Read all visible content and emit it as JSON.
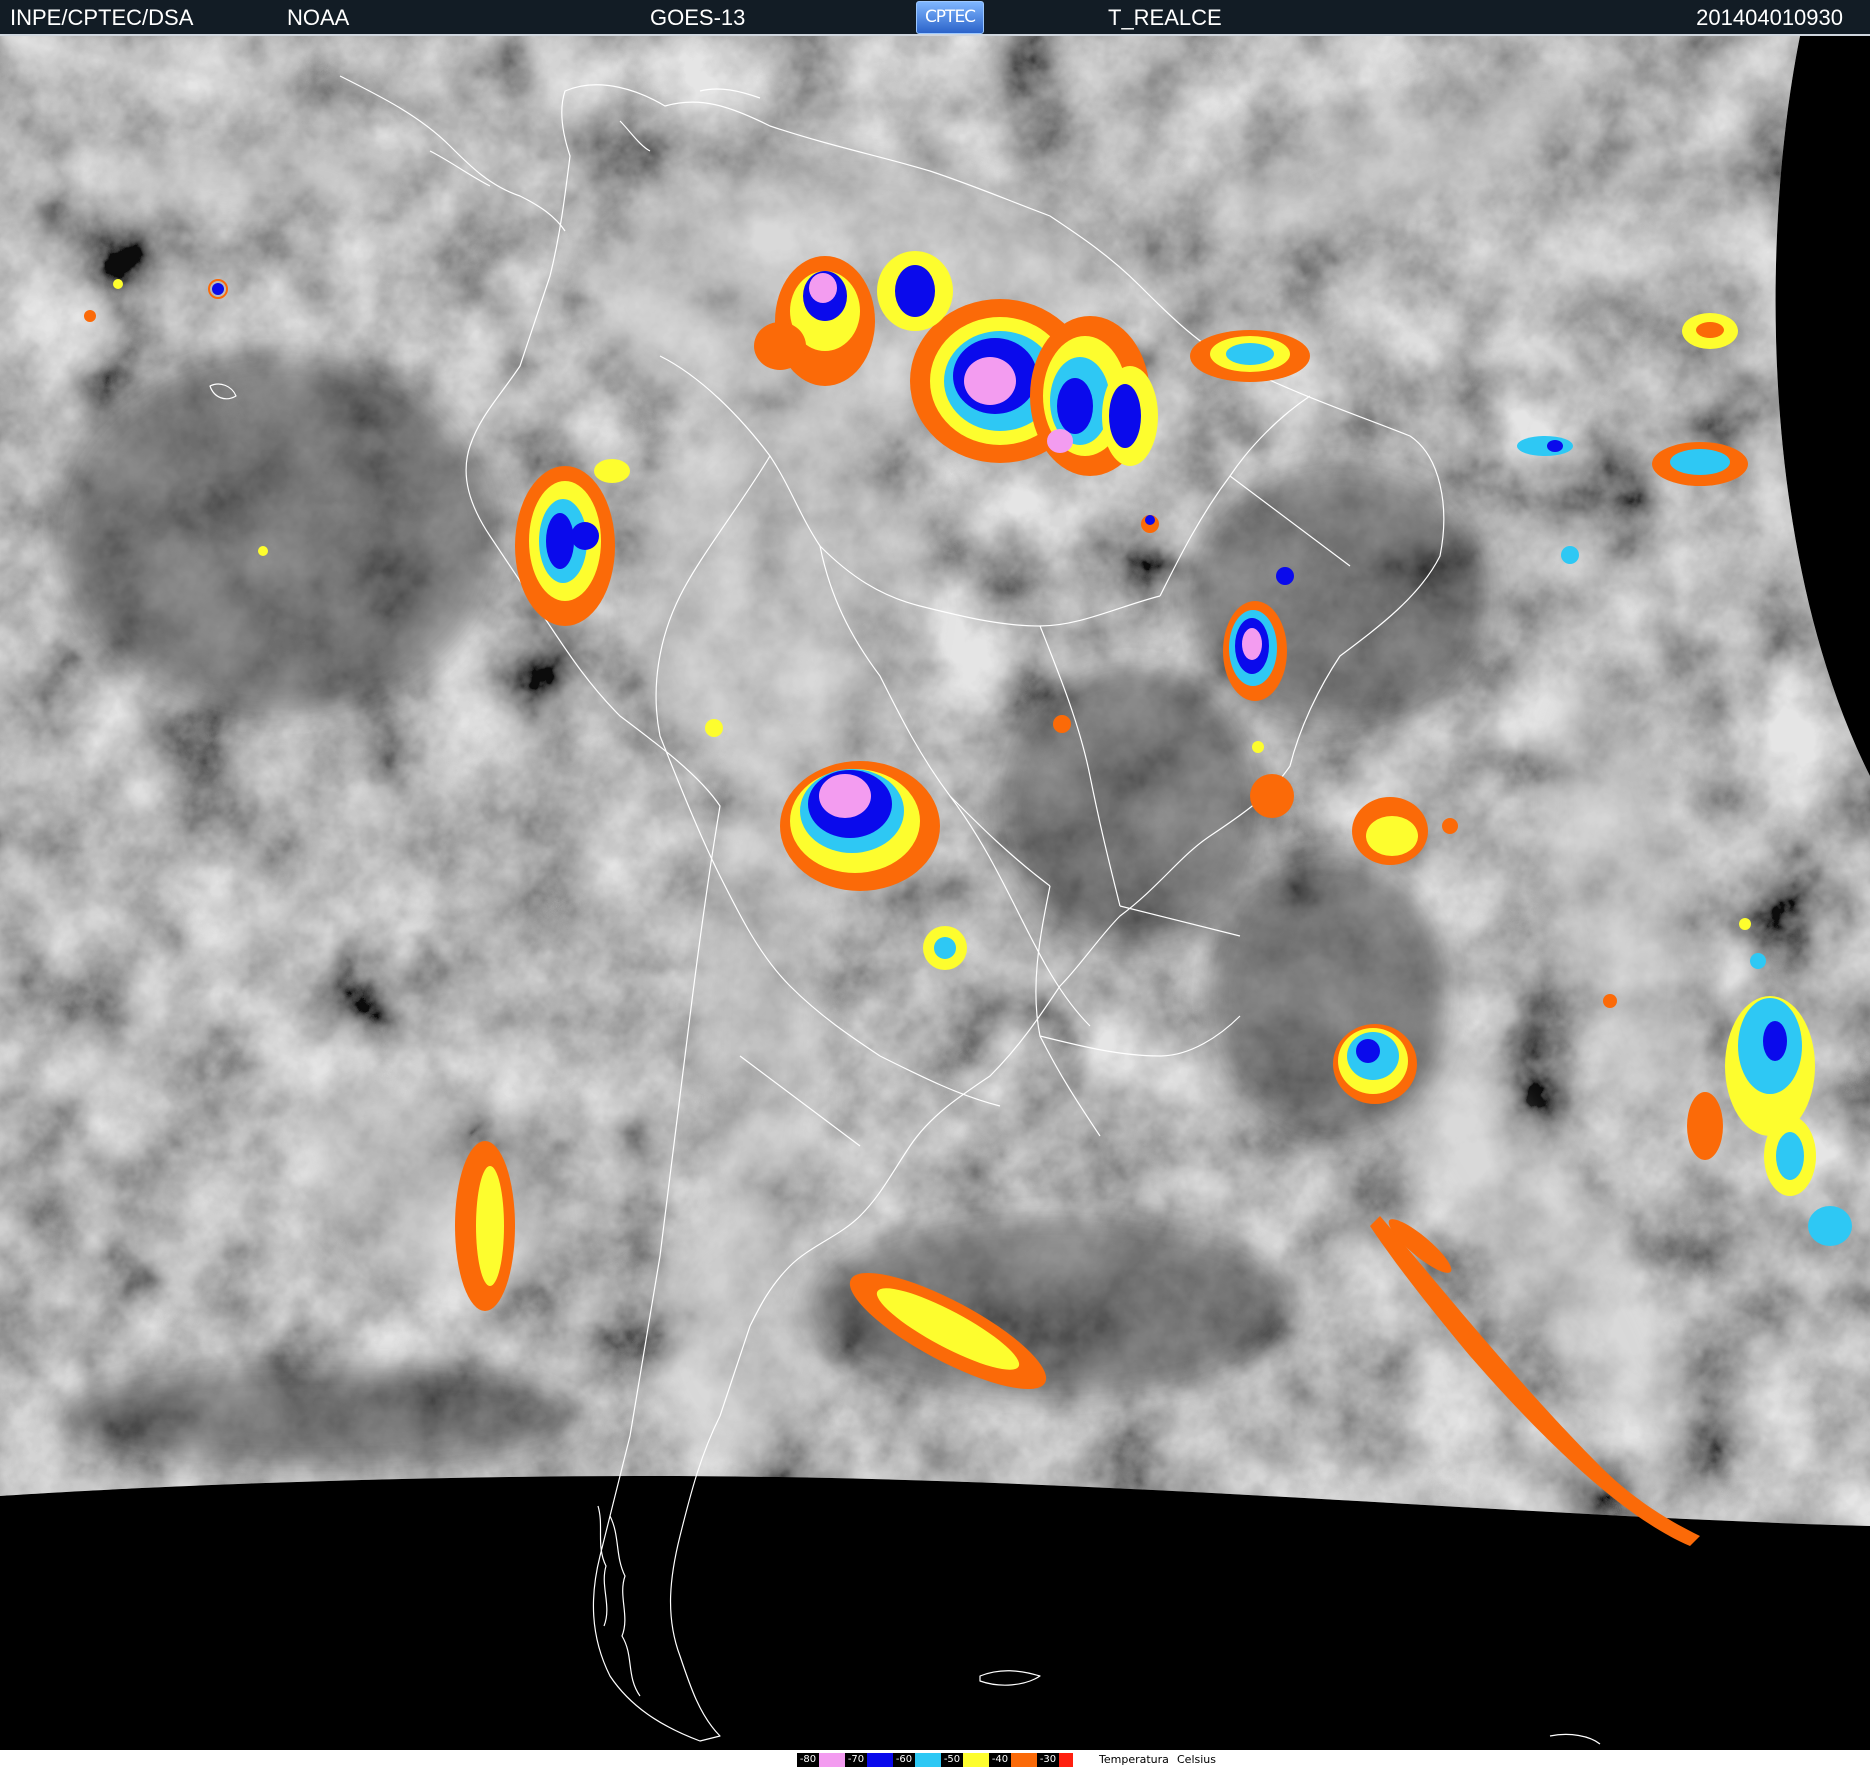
{
  "header": {
    "organization": "INPE/CPTEC/DSA",
    "agency": "NOAA",
    "satellite": "GOES-13",
    "logo_text": "CPTEC",
    "product": "T_REALCE",
    "timestamp": "201404010930"
  },
  "legend": {
    "items": [
      {
        "label": "-80",
        "color": "#f39cf0"
      },
      {
        "label": "-70",
        "color": "#0a0aec"
      },
      {
        "label": "-60",
        "color": "#2ec8f4"
      },
      {
        "label": "-50",
        "color": "#fdfd2e"
      },
      {
        "label": "-40",
        "color": "#fb6a08"
      },
      {
        "label": "-30",
        "color": "#ff2010"
      }
    ],
    "title": "Temperatura",
    "unit": "Celsius"
  }
}
